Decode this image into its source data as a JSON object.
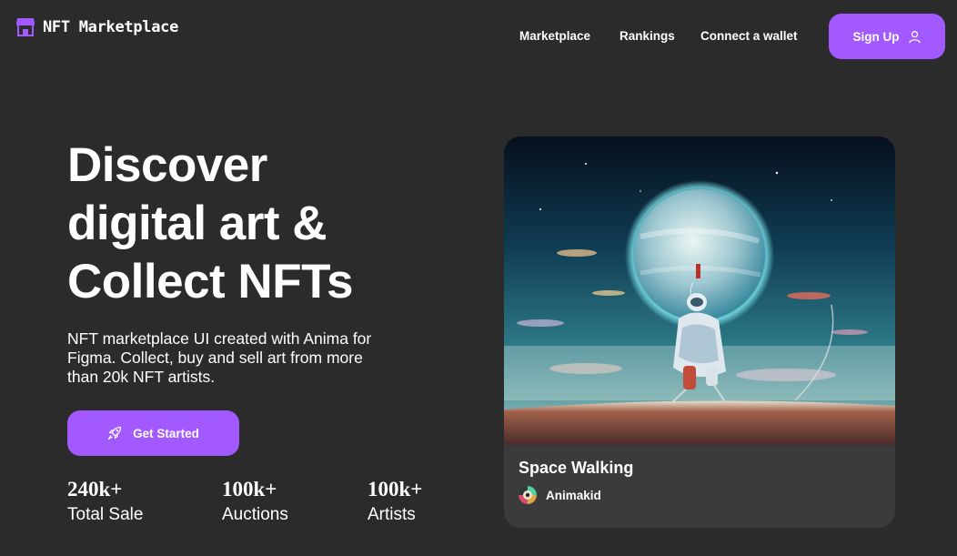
{
  "nav": {
    "logo_text": "NFT Marketplace",
    "links": [
      "Marketplace",
      "Rankings",
      "Connect a wallet"
    ],
    "signup_label": "Sign Up"
  },
  "hero": {
    "headline_lines": [
      "Discover",
      "digital art &",
      "Collect NFTs"
    ],
    "subtitle_lines": [
      "NFT marketplace UI created with Anima for",
      "Figma. Collect, buy and sell art from more",
      "than 20k NFT artists."
    ],
    "cta_label": "Get Started",
    "stats": [
      {
        "value": "240k+",
        "label": "Total Sale"
      },
      {
        "value": "100k+",
        "label": "Auctions"
      },
      {
        "value": "100k+",
        "label": "Artists"
      }
    ]
  },
  "card": {
    "title": "Space Walking",
    "artist": "Animakid"
  },
  "colors": {
    "background": "#2b2b2b",
    "accent": "#a259ff",
    "card": "#3b3b3b",
    "text": "#ffffff"
  },
  "icons": {
    "logo": "storefront-icon",
    "signup": "user-icon",
    "cta": "rocket-icon"
  }
}
